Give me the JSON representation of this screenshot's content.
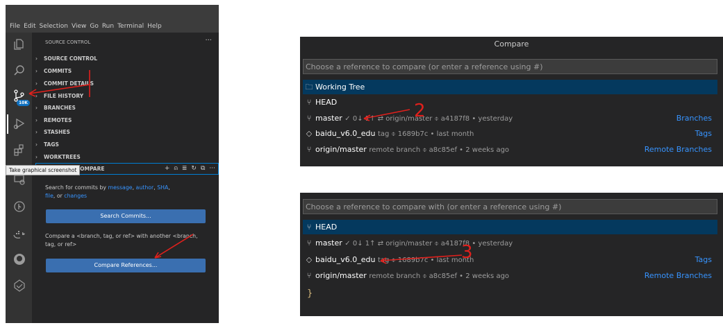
{
  "menubar": {
    "items": [
      "File",
      "Edit",
      "Selection",
      "View",
      "Go",
      "Run",
      "Terminal",
      "Help"
    ]
  },
  "activity_icons": [
    "explorer-icon",
    "search-icon",
    "source-control-icon",
    "run-debug-icon",
    "extensions-icon",
    "remote-explorer-icon",
    "timeline-icon",
    "docker-icon",
    "github-icon",
    "gitlens-icon"
  ],
  "badge": "10K",
  "tooltip": "Take graphical screenshot",
  "sidebar": {
    "title": "SOURCE CONTROL",
    "more": "···",
    "sections": [
      "SOURCE CONTROL",
      "COMMITS",
      "COMMIT DETAILS",
      "FILE HISTORY",
      "BRANCHES",
      "REMOTES",
      "STASHES",
      "TAGS",
      "WORKTREES",
      "SEARCH & COMPARE"
    ],
    "search_compare": {
      "text1_a": "Search for commits by ",
      "link_message": "message",
      "text1_b": ", ",
      "link_author": "author",
      "text1_c": ", ",
      "link_sha": "SHA",
      "text1_d": ",",
      "link_file": "file",
      "text1_e": ", or ",
      "link_changes": "changes",
      "search_button": "Search Commits...",
      "text2": "Compare a <branch, tag, or ref> with another <branch, tag, or ref>",
      "compare_button": "Compare References..."
    }
  },
  "compare1": {
    "title": "Compare",
    "placeholder": "Choose a reference to compare  (or enter a reference using #)",
    "rows": [
      {
        "label": "Working Tree",
        "desc": "",
        "right": ""
      },
      {
        "label": "HEAD",
        "desc": "",
        "right": ""
      },
      {
        "label": "master",
        "desc": "✓  0↓ 1↑  ⇄  origin/master  ⌽  a4187f8  •  yesterday",
        "right": "Branches"
      },
      {
        "label": "baidu_v6.0_edu",
        "desc": "tag  ⌽  1689b7c  •  last month",
        "right": "Tags"
      },
      {
        "label": "origin/master",
        "desc": "remote branch  ⌽  a8c85ef  •  2 weeks ago",
        "right": "Remote Branches"
      }
    ]
  },
  "compare2": {
    "placeholder": "Choose a reference to compare with  (or enter a reference using #)",
    "rows": [
      {
        "label": "HEAD",
        "desc": "",
        "right": ""
      },
      {
        "label": "master",
        "desc": "✓  0↓ 1↑  ⇄  origin/master  ⌽  a4187f8  •  yesterday",
        "right": ""
      },
      {
        "label": "baidu_v6.0_edu",
        "desc": "tag  ⌽  1689b7c  •  last month",
        "right": "Tags"
      },
      {
        "label": "origin/master",
        "desc": "remote branch  ⌽  a8c85ef  •  2 weeks ago",
        "right": "Remote Branches"
      }
    ],
    "brace": "}"
  },
  "annotations": [
    "2",
    "3"
  ],
  "colors": {
    "accent": "#3794ff",
    "selection": "#04395e",
    "button": "#3a6fb0",
    "annotation": "#e0201c"
  }
}
